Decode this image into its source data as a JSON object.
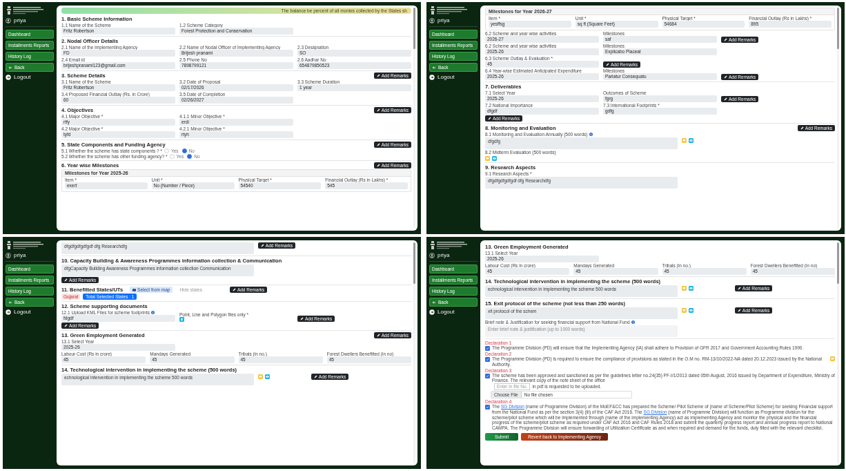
{
  "panels": [
    {
      "sidebar": {
        "user": "priya",
        "nav": [
          {
            "label": "Dashboard",
            "kind": "link"
          },
          {
            "label": "Installments Reports",
            "kind": "link"
          },
          {
            "label": "History Log",
            "kind": "link"
          },
          {
            "label": "Back",
            "kind": "back"
          }
        ],
        "logout": "Logout"
      },
      "blocks": [
        {
          "kind": "banner",
          "text": "The balance be percent of all monies collected by the States sh"
        },
        {
          "kind": "heading",
          "text": "1. Basic Scheme Information"
        },
        {
          "kind": "fields",
          "fields": [
            {
              "label": "1.1 Name of the Scheme",
              "value": "Fritz Robertson"
            },
            {
              "label": "1.2 Scheme Category",
              "value": "Forest Protection and Conservation"
            }
          ]
        },
        {
          "kind": "heading",
          "text": "2. Nodal Officer Details"
        },
        {
          "kind": "fields",
          "fields": [
            {
              "label": "2.1 Name of the Implementing Agency",
              "value": "FD"
            },
            {
              "label": "2.2 Name of Nodal Officer of Implementing Agency",
              "value": "Brijesh pranami"
            },
            {
              "label": "2.3 Designation",
              "value": "SO"
            }
          ]
        },
        {
          "kind": "fields",
          "fields": [
            {
              "label": "2.4 Email id",
              "value": "brijeshpranami123@gmail.com"
            },
            {
              "label": "2.5 Phone No",
              "value": "7898799121"
            },
            {
              "label": "2.6 Aadhar No",
              "value": "654879850523"
            }
          ]
        },
        {
          "kind": "heading",
          "text": "3. Scheme Details",
          "remarks": "Add Remarks"
        },
        {
          "kind": "fields",
          "fields": [
            {
              "label": "3.1 Name of the Scheme",
              "value": "Fritz Robertson"
            },
            {
              "label": "3.2 Date of Proposal",
              "value": "02/17/2026"
            },
            {
              "label": "3.3 Scheme Duration",
              "value": "1 year"
            }
          ]
        },
        {
          "kind": "fields",
          "fields": [
            {
              "label": "3.4 Proposed Financial Outlay (Rs. in Crore)",
              "value": "60"
            },
            {
              "label": "3.5 Date of Completion",
              "value": "02/26/2027"
            }
          ]
        },
        {
          "kind": "heading",
          "text": "4. Objectives",
          "remarks": "Add Remarks"
        },
        {
          "kind": "fields",
          "fields": [
            {
              "label": "4.1 Major Objective *",
              "value": "rtfy"
            },
            {
              "label": "4.1.1 Minor Objective *",
              "value": "erdi"
            }
          ]
        },
        {
          "kind": "fields",
          "fields": [
            {
              "label": "4.2 Major Objective *",
              "value": "tyfd"
            },
            {
              "label": "4.2.1 Minor Objective *",
              "value": "rtyh"
            }
          ]
        },
        {
          "kind": "heading",
          "text": "5. State Components and Funding Agency",
          "remarks": "Add Remarks"
        },
        {
          "kind": "radio",
          "label": "5.1 Whether the scheme has state components ? *",
          "options": [
            {
              "label": "Yes",
              "selected": false
            },
            {
              "label": "No",
              "selected": true
            }
          ]
        },
        {
          "kind": "radio",
          "label": "5.2 Whether the scheme has other funding agency? *",
          "options": [
            {
              "label": "Yes",
              "selected": false
            },
            {
              "label": "No",
              "selected": true
            }
          ]
        },
        {
          "kind": "heading",
          "text": "6. Year wise Milestones",
          "remarks": "Add Remarks"
        },
        {
          "kind": "milestones",
          "title": "Milestones for Year 2025-26",
          "fields": [
            {
              "label": "Item *",
              "value": "exert"
            },
            {
              "label": "Unit *",
              "value": "No (Number / Piece)"
            },
            {
              "label": "Physical Target *",
              "value": "54540"
            },
            {
              "label": "Financial Outlay (Rs in Lakhs) *",
              "value": "545"
            }
          ]
        }
      ]
    },
    {
      "sidebar": {
        "user": "priya",
        "nav": [
          {
            "label": "Dashboard",
            "kind": "link"
          },
          {
            "label": "Installments Reports",
            "kind": "link"
          },
          {
            "label": "History Log",
            "kind": "link"
          },
          {
            "label": "Back",
            "kind": "back"
          }
        ],
        "logout": "Logout"
      },
      "blocks": [
        {
          "kind": "milestones",
          "title": "Milestones for Year 2026-27",
          "fields": [
            {
              "label": "Item *",
              "value": "yesffsg"
            },
            {
              "label": "Unit *",
              "value": "sq ft (Square Feet)"
            },
            {
              "label": "Physical Target *",
              "value": "54684"
            },
            {
              "label": "Financial Outlay (Rs in Lakhs) *",
              "value": "895"
            }
          ]
        },
        {
          "kind": "fields",
          "fields": [
            {
              "label": "6.2 Scheme and year wise activities",
              "value": "2026-27"
            },
            {
              "label": "Milestones",
              "value": "saf"
            }
          ],
          "remarks": "Add Remarks"
        },
        {
          "kind": "fields",
          "fields": [
            {
              "label": "6.2 Scheme and year wise activities",
              "value": "2025-26"
            },
            {
              "label": "Milestones",
              "value": "Explicabo Placeat"
            }
          ]
        },
        {
          "kind": "fields",
          "fields": [
            {
              "label": "6.3 Scheme Outlay & Evaluation *",
              "value": "45"
            }
          ],
          "remarks": "Add Remarks"
        },
        {
          "kind": "fields",
          "fields": [
            {
              "label": "6.4 Year-wise Estimated Anticipated Expenditure",
              "value": "2025-26"
            },
            {
              "label": "Milestones",
              "value": "Pariatur Consequatu"
            }
          ],
          "remarks": "Add Remarks"
        },
        {
          "kind": "heading",
          "text": "7. Deliverables"
        },
        {
          "kind": "fields",
          "fields": [
            {
              "label": "7.1 Select Year",
              "value": "2025-26"
            },
            {
              "label": "Outcomes of Scheme",
              "value": "fgrg"
            }
          ],
          "remarks": "Add Remarks"
        },
        {
          "kind": "fields",
          "fields": [
            {
              "label": "7.2 National Importance",
              "value": "dfgdf"
            },
            {
              "label": "7.3 International Footprints *",
              "value": "gdfg"
            }
          ]
        },
        {
          "kind": "remarks",
          "text": "Add Remarks"
        },
        {
          "kind": "heading",
          "text": "8. Monitoring and Evaluation",
          "remarks": "Add Remarks"
        },
        {
          "kind": "textarea",
          "label": "8.1 Monitoring and Evaluation Annually (500 words)",
          "info": true,
          "value": "dfgdfg",
          "tools": true
        },
        {
          "kind": "textarea",
          "label": "8.2 Midterm Evaluation (500 words)",
          "tools": true
        },
        {
          "kind": "heading",
          "text": "9. Research Aspects"
        },
        {
          "kind": "textarea",
          "label": "9.1 Research Aspects *",
          "value": "dfgdfgdfgdfgdf dfg Researchdfg"
        }
      ]
    },
    {
      "sidebar": {
        "user": "priya",
        "nav": [
          {
            "label": "Dashboard",
            "kind": "link"
          },
          {
            "label": "Installments Reports",
            "kind": "link"
          },
          {
            "label": "History Log",
            "kind": "link"
          },
          {
            "label": "Back",
            "kind": "back"
          }
        ],
        "logout": "Logout"
      },
      "blocks": [
        {
          "kind": "textarea",
          "value": "dfgdfgdfgdfgdf dfg Researchdfg",
          "remarks": "Add Remarks"
        },
        {
          "kind": "heading",
          "text": "10. Capacity Building & Awareness Programmes information collection & Communication"
        },
        {
          "kind": "textarea",
          "value": "dfgCapacity Building Awareness Programmes information collection Communication"
        },
        {
          "kind": "remarks",
          "text": "Add Remarks"
        },
        {
          "kind": "states",
          "title": "11. Benefitted States/UTs",
          "map_button": "Select from map",
          "hint": "Hide states",
          "remarks": "Add Remarks",
          "tag": "Gujarat",
          "total": "Total Selected States : 1"
        },
        {
          "kind": "heading",
          "text": "12. Scheme supporting documents"
        },
        {
          "kind": "upload",
          "label": "12.1 Upload KML Files for scheme footprints",
          "value": "fdgdf",
          "file_label": "Point, Line and Polygon files only *",
          "remarks": "Add Remarks"
        },
        {
          "kind": "remarks",
          "text": "Add Remarks"
        },
        {
          "kind": "heading",
          "text": "13. Green Employment Generated",
          "remarks": "Add Remarks"
        },
        {
          "kind": "fields",
          "fields": [
            {
              "label": "13.1 Select Year",
              "value": "2025-26"
            }
          ]
        },
        {
          "kind": "fields",
          "fields": [
            {
              "label": "Labour Cost (Rs in crore)",
              "value": "45"
            },
            {
              "label": "Mandays Generated",
              "value": "45"
            },
            {
              "label": "Tribals (in no.)",
              "value": "45"
            },
            {
              "label": "Forest Dwellers Benefitted (in no)",
              "value": "45"
            }
          ]
        },
        {
          "kind": "heading",
          "text": "14. Technological intervention in implementing the scheme (500 words)"
        },
        {
          "kind": "textarea",
          "value": "echnological intervention in implementing the scheme 500 words",
          "tools": true,
          "remarks": "Add Remarks"
        }
      ]
    },
    {
      "sidebar": {
        "user": "priya",
        "nav": [
          {
            "label": "Dashboard",
            "kind": "link"
          },
          {
            "label": "Installments Reports",
            "kind": "link"
          },
          {
            "label": "History Log",
            "kind": "link"
          },
          {
            "label": "Back",
            "kind": "back"
          }
        ],
        "logout": "Logout"
      },
      "blocks": [
        {
          "kind": "heading",
          "text": "13. Green Employment Generated"
        },
        {
          "kind": "fields",
          "fields": [
            {
              "label": "13.1 Select Year",
              "value": "2025-26"
            }
          ]
        },
        {
          "kind": "fields",
          "fields": [
            {
              "label": "Labour Cost (Rs in crore)",
              "value": "45"
            },
            {
              "label": "Mandays Generated",
              "value": "45"
            },
            {
              "label": "Tribals (in no.)",
              "value": "45"
            },
            {
              "label": "Forest Dwellers Benefitted (in no)",
              "value": "45"
            }
          ]
        },
        {
          "kind": "heading",
          "text": "14. Technological intervention in implementing the scheme (500 words)"
        },
        {
          "kind": "textarea",
          "value": "echnological intervention in implementing the scheme 500 words",
          "tools": true,
          "remarks": "Add Remarks"
        },
        {
          "kind": "heading",
          "text": "15. Exit protocol of the scheme (not less than 250 words)"
        },
        {
          "kind": "textarea",
          "value": "xit protocol of the schem",
          "tools": true,
          "remarks": "Add Remarks"
        },
        {
          "kind": "textarea",
          "label": "Brief note & Justification for seeking financial support from National Fund",
          "info": true,
          "placeholder": "Enter brief note & justification (up to 1000 words)"
        },
        {
          "kind": "declaration",
          "title": "Declaration 1",
          "checked": true,
          "segments": [
            {
              "kind": "text",
              "text": "The Programme Division (PD) will ensure that the Implementing Agency (IA) shall adhere to Provision of GFR 2017 and Government Accounting Rules 1990."
            }
          ]
        },
        {
          "kind": "declaration",
          "title": "Declaration 2",
          "checked": true,
          "comment": true,
          "segments": [
            {
              "kind": "text",
              "text": "The Programme Division (PD) is required to ensure the compliance of provisions as stated in the O.M no. RM-13/10/2022-NA dated 20.12.2023 issued by the National Authority."
            }
          ]
        },
        {
          "kind": "declaration",
          "title": "Declaration 3",
          "checked": true,
          "segments": [
            {
              "kind": "text",
              "text": "The scheme has been approved and sanctioned as per the guidelines letter no.24(35) PF-I/1/2013 dated 05th August, 2016 issued by Department of Expenditure, Ministry of Finance. The relevant copy of the note sheet of the office"
            }
          ],
          "input": {
            "placeholder": "Enter in file No."
          },
          "after": "in pdf is requested to be uploaded."
        },
        {
          "kind": "file",
          "button": "Choose File",
          "status": "No file chosen"
        },
        {
          "kind": "declaration",
          "title": "Declaration 4",
          "checked": true,
          "segments": [
            {
              "kind": "text",
              "text": "The "
            },
            {
              "kind": "link",
              "text": "SG Division"
            },
            {
              "kind": "text",
              "text": " (name of Programme Division) of the MoEF&CC has prepared the Scheme/ Pilot Scheme of (name of Scheme/Pilot Scheme) for seeking Financial support from the National Fund as per the section 3(4) (iii) of the CAF Act 2016. The "
            },
            {
              "kind": "link",
              "text": "SG Division"
            },
            {
              "kind": "text",
              "text": " (name of Programme Division) will function as Programme division for the scheme/pilot scheme which will be implemented through (name of the implementing Agency) act as implementing Agency and monitor the physical and the financial progress of the scheme/pilot scheme as required under CAF Act 2016 and CAF Rules 2018 and submit the quarterly progress report and annual progress report to National CAMPA. The Programme Division will ensure forwarding of Utilization Certificate as and when required and demand for the funds, duly filled with the relevant checklist."
            }
          ]
        },
        {
          "kind": "actions",
          "buttons": [
            {
              "label": "Submit",
              "kind": "submit"
            },
            {
              "label": "Revert back to Implementing Agency",
              "kind": "revert"
            }
          ]
        }
      ]
    }
  ]
}
